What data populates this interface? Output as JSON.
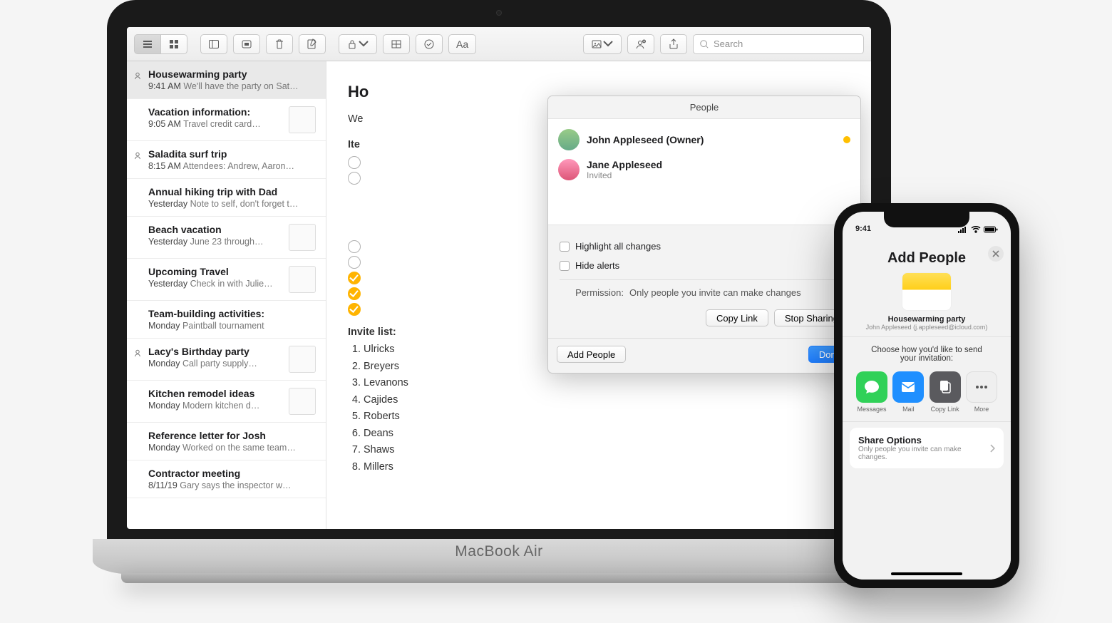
{
  "toolbar": {
    "search_placeholder": "Search"
  },
  "notes": [
    {
      "shared": true,
      "title": "Housewarming party",
      "time": "9:41 AM",
      "snippet": "We'll have the party on Sat…",
      "selected": true,
      "thumb": false
    },
    {
      "shared": false,
      "title": "Vacation information:",
      "time": "9:05 AM",
      "snippet": "Travel credit card…",
      "thumb": true
    },
    {
      "shared": true,
      "title": "Saladita surf trip",
      "time": "8:15 AM",
      "snippet": "Attendees: Andrew, Aaron…",
      "thumb": false
    },
    {
      "shared": false,
      "title": "Annual hiking trip with Dad",
      "time": "Yesterday",
      "snippet": "Note to self, don't forget t…",
      "thumb": false
    },
    {
      "shared": false,
      "title": "Beach vacation",
      "time": "Yesterday",
      "snippet": "June 23 through…",
      "thumb": true
    },
    {
      "shared": false,
      "title": "Upcoming Travel",
      "time": "Yesterday",
      "snippet": "Check in with Julie…",
      "thumb": true
    },
    {
      "shared": false,
      "title": "Team-building activities:",
      "time": "Monday",
      "snippet": "Paintball tournament",
      "thumb": false
    },
    {
      "shared": true,
      "title": "Lacy's Birthday party",
      "time": "Monday",
      "snippet": "Call party supply…",
      "thumb": true
    },
    {
      "shared": false,
      "title": "Kitchen remodel ideas",
      "time": "Monday",
      "snippet": "Modern kitchen d…",
      "thumb": true
    },
    {
      "shared": false,
      "title": "Reference letter for Josh",
      "time": "Monday",
      "snippet": "Worked on the same team…",
      "thumb": false
    },
    {
      "shared": false,
      "title": "Contractor meeting",
      "time": "8/11/19",
      "snippet": "Gary says the inspector w…",
      "thumb": false
    }
  ],
  "editor": {
    "title_truncated": "Ho",
    "line1_truncated": "We",
    "section_items": "Ite",
    "invite_heading": "Invite list:",
    "invitees": [
      "Ulricks",
      "Breyers",
      "Levanons",
      "Cajides",
      "Roberts",
      "Deans",
      "Shaws",
      "Millers"
    ]
  },
  "popover": {
    "title": "People",
    "people": [
      {
        "name": "John Appleseed (Owner)",
        "sub": ""
      },
      {
        "name": "Jane Appleseed",
        "sub": "Invited"
      }
    ],
    "highlight_label": "Highlight all changes",
    "hide_label": "Hide alerts",
    "permission_label": "Permission:",
    "permission_value": "Only people you invite can make changes",
    "copy_link": "Copy Link",
    "stop_sharing": "Stop Sharing",
    "add_people": "Add People",
    "done": "Done"
  },
  "macbook_label": "MacBook Air",
  "iphone": {
    "time": "9:41",
    "sheet_title": "Add People",
    "note_title": "Housewarming party",
    "note_sub": "John Appleseed (j.appleseed@icloud.com)",
    "how_text": "Choose how you'd like to send your invitation:",
    "share_items": [
      {
        "label": "Messages",
        "color": "#30d158"
      },
      {
        "label": "Mail",
        "color": "#1f8fff"
      },
      {
        "label": "Copy Link",
        "color": "#5a5a5e"
      },
      {
        "label": "More",
        "color": "#efefef"
      }
    ],
    "share_options_title": "Share Options",
    "share_options_sub": "Only people you invite can make changes."
  }
}
